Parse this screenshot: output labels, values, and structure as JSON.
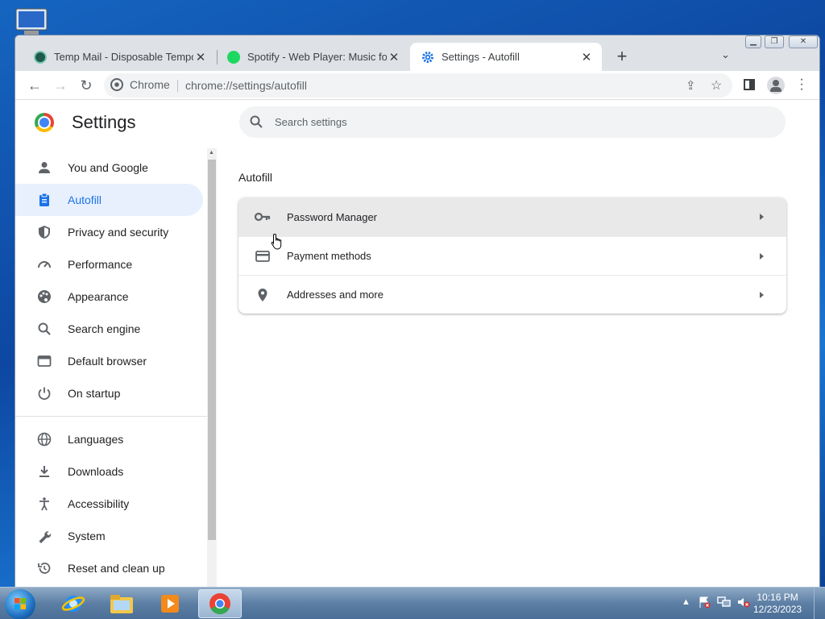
{
  "browser": {
    "tabs": [
      {
        "title": "Temp Mail - Disposable Temporary",
        "favicon": "tempmail-icon"
      },
      {
        "title": "Spotify - Web Player: Music for e",
        "favicon": "spotify-icon"
      },
      {
        "title": "Settings - Autofill",
        "favicon": "settings-gear-icon",
        "active": true
      }
    ],
    "omnibox": {
      "site_label": "Chrome",
      "url": "chrome://settings/autofill"
    }
  },
  "settings": {
    "title": "Settings",
    "search_placeholder": "Search settings",
    "nav": [
      {
        "label": "You and Google",
        "icon": "person-icon"
      },
      {
        "label": "Autofill",
        "icon": "clipboard-icon",
        "selected": true
      },
      {
        "label": "Privacy and security",
        "icon": "shield-icon"
      },
      {
        "label": "Performance",
        "icon": "gauge-icon"
      },
      {
        "label": "Appearance",
        "icon": "palette-icon"
      },
      {
        "label": "Search engine",
        "icon": "search-icon"
      },
      {
        "label": "Default browser",
        "icon": "browser-icon"
      },
      {
        "label": "On startup",
        "icon": "power-icon"
      },
      {
        "label": "Languages",
        "icon": "globe-icon"
      },
      {
        "label": "Downloads",
        "icon": "download-icon"
      },
      {
        "label": "Accessibility",
        "icon": "accessibility-icon"
      },
      {
        "label": "System",
        "icon": "wrench-icon"
      },
      {
        "label": "Reset and clean up",
        "icon": "history-icon"
      }
    ],
    "section_title": "Autofill",
    "rows": [
      {
        "label": "Password Manager",
        "icon": "key-icon"
      },
      {
        "label": "Payment methods",
        "icon": "credit-card-icon"
      },
      {
        "label": "Addresses and more",
        "icon": "location-pin-icon"
      }
    ]
  },
  "taskbar": {
    "time": "10:16 PM",
    "date": "12/23/2023"
  },
  "colors": {
    "accent": "#1a73e8",
    "selected_bg": "#e8f0fe"
  }
}
